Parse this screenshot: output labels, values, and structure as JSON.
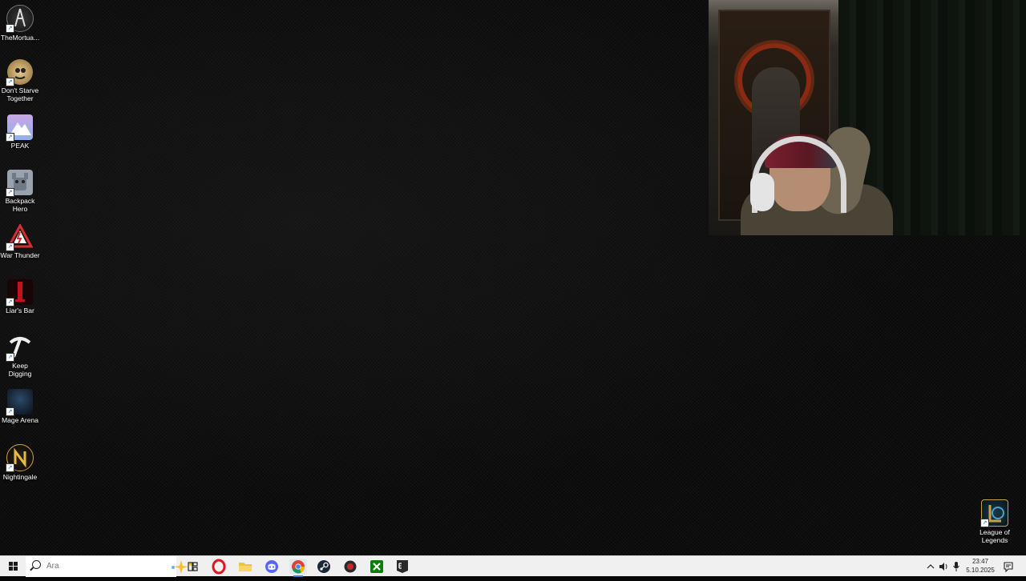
{
  "desktop_icons": [
    {
      "label": "TheMortua...",
      "icon": "the-mortuary-assistant-icon",
      "color": "#2b2b2b"
    },
    {
      "label": "Don't Starve Together",
      "icon": "dont-starve-together-icon",
      "color": "#c9a062"
    },
    {
      "label": "PEAK",
      "icon": "peak-icon",
      "color": "#a5b8e8"
    },
    {
      "label": "Backpack Hero",
      "icon": "backpack-hero-icon",
      "color": "#8d98a6"
    },
    {
      "label": "War Thunder",
      "icon": "war-thunder-icon",
      "color": "#c62828"
    },
    {
      "label": "Liar's Bar",
      "icon": "liars-bar-icon",
      "color": "#7a0f14"
    },
    {
      "label": "Keep Digging",
      "icon": "keep-digging-icon",
      "color": "#e0e0e0"
    },
    {
      "label": "Mage Arena",
      "icon": "mage-arena-icon",
      "color": "#1b2a3a"
    },
    {
      "label": "Nightingale",
      "icon": "nightingale-icon",
      "color": "#d2a23a"
    }
  ],
  "corner_icon": {
    "label": "League of Legends",
    "icon": "league-of-legends-icon",
    "color": "#c8a24a"
  },
  "taskbar": {
    "search_placeholder": "Ara",
    "apps": [
      {
        "name": "task-view-button",
        "icon": "task-view-icon"
      },
      {
        "name": "opera-button",
        "icon": "opera-icon",
        "color": "#e3141e"
      },
      {
        "name": "file-explorer-button",
        "icon": "folder-icon",
        "color": "#f3c13a"
      },
      {
        "name": "discord-button",
        "icon": "discord-icon",
        "color": "#5865f2"
      },
      {
        "name": "chrome-button",
        "icon": "chrome-icon",
        "color": "#4285f4",
        "active": true
      },
      {
        "name": "steam-button",
        "icon": "steam-icon",
        "color": "#1b2838"
      },
      {
        "name": "app-button",
        "icon": "app-icon",
        "color": "#c62828"
      },
      {
        "name": "xbox-button",
        "icon": "xbox-icon",
        "color": "#107c10"
      },
      {
        "name": "epic-games-button",
        "icon": "epic-games-icon",
        "color": "#2a2a2a"
      }
    ],
    "tray": {
      "time": "23:47",
      "date": "5.10.2025"
    }
  }
}
